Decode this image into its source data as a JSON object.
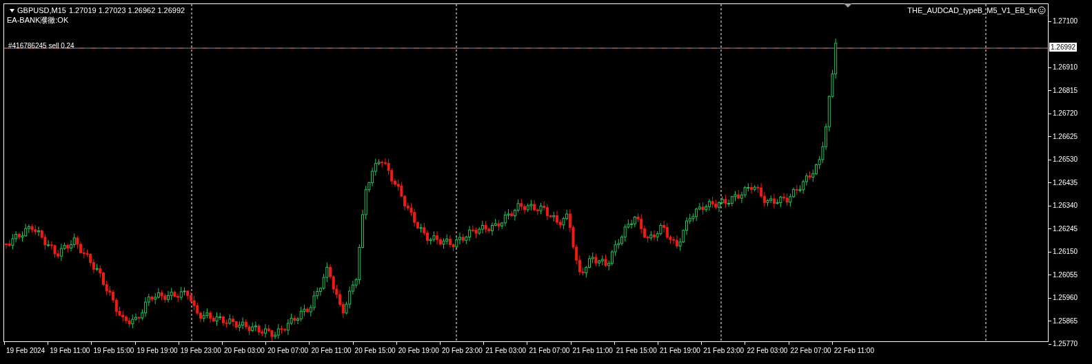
{
  "chart": {
    "symbol": "GBPUSD,M15",
    "ohlc": "1.27019 1.27023 1.26962 1.26992",
    "status_text": "EA-BANK濮徹:OK",
    "order_label": "#416786245 sell 0.24",
    "expert": "THE_AUDCAD_typeB_M5_V1_EB_fix"
  },
  "price_axis": {
    "ticks": [
      "1.27100",
      "1.26910",
      "1.26815",
      "1.26720",
      "1.26625",
      "1.26530",
      "1.26435",
      "1.26340",
      "1.26245",
      "1.26150",
      "1.26055",
      "1.25960",
      "1.25865",
      "1.25770"
    ],
    "current_price": "1.26992"
  },
  "time_axis": {
    "labels": [
      "19 Feb 2024",
      "19 Feb 11:00",
      "19 Feb 15:00",
      "19 Feb 19:00",
      "19 Feb 23:00",
      "20 Feb 03:00",
      "20 Feb 07:00",
      "20 Feb 11:00",
      "20 Feb 15:00",
      "20 Feb 19:00",
      "20 Feb 23:00",
      "21 Feb 03:00",
      "21 Feb 07:00",
      "21 Feb 11:00",
      "21 Feb 15:00",
      "21 Feb 19:00",
      "21 Feb 23:00",
      "22 Feb 03:00",
      "22 Feb 07:00",
      "22 Feb 11:00"
    ]
  }
}
